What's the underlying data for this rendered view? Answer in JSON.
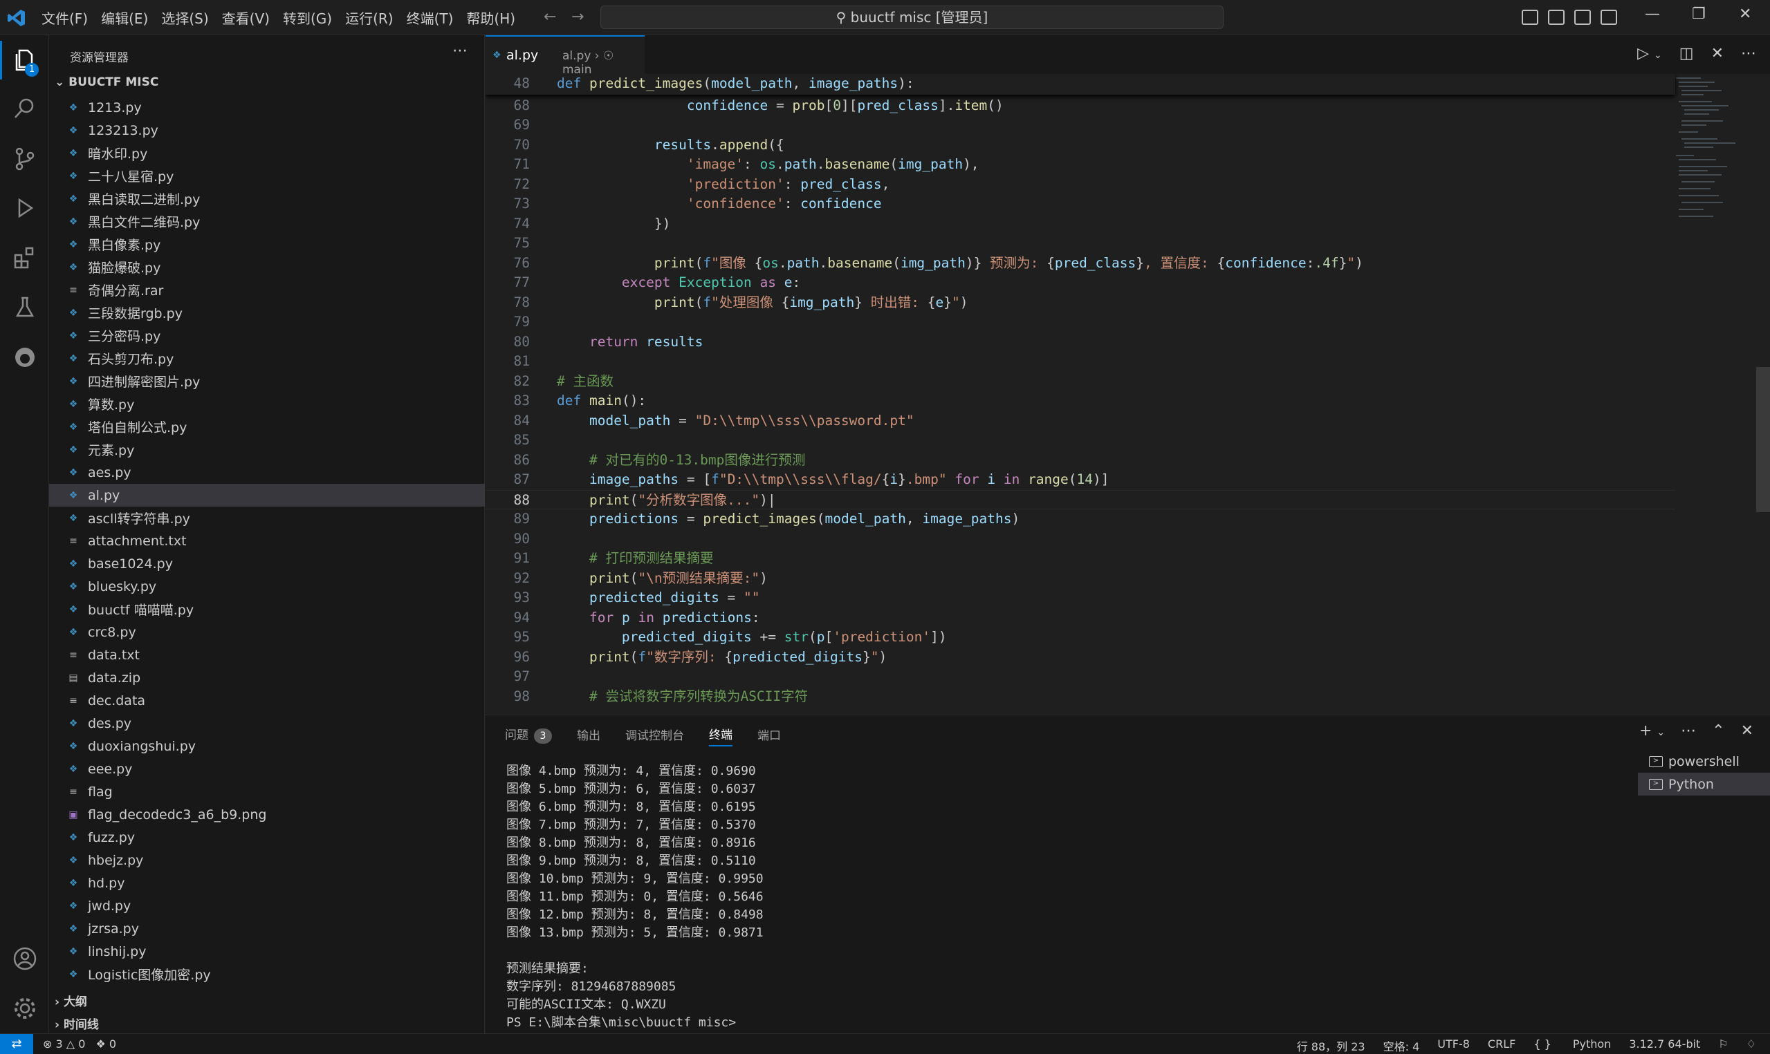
{
  "titlebar": {
    "menus": [
      "文件(F)",
      "编辑(E)",
      "选择(S)",
      "查看(V)",
      "转到(G)",
      "运行(R)",
      "终端(T)",
      "帮助(H)"
    ],
    "search": "buuctf misc [管理员]"
  },
  "activity": {
    "explorer_badge": "1"
  },
  "sidebar": {
    "title": "资源管理器",
    "section": "BUUCTF MISC",
    "files": [
      {
        "name": "1213.py",
        "type": "py"
      },
      {
        "name": "123213.py",
        "type": "py"
      },
      {
        "name": "暗水印.py",
        "type": "py"
      },
      {
        "name": "二十八星宿.py",
        "type": "py"
      },
      {
        "name": "黑白读取二进制.py",
        "type": "py"
      },
      {
        "name": "黑白文件二维码.py",
        "type": "py"
      },
      {
        "name": "黑白像素.py",
        "type": "py"
      },
      {
        "name": "猫脸爆破.py",
        "type": "py"
      },
      {
        "name": "奇偶分离.rar",
        "type": "txt"
      },
      {
        "name": "三段数据rgb.py",
        "type": "py"
      },
      {
        "name": "三分密码.py",
        "type": "py"
      },
      {
        "name": "石头剪刀布.py",
        "type": "py"
      },
      {
        "name": "四进制解密图片.py",
        "type": "py"
      },
      {
        "name": "算数.py",
        "type": "py"
      },
      {
        "name": "塔伯自制公式.py",
        "type": "py"
      },
      {
        "name": "元素.py",
        "type": "py"
      },
      {
        "name": "aes.py",
        "type": "py"
      },
      {
        "name": "al.py",
        "type": "py",
        "selected": true
      },
      {
        "name": "ascll转字符串.py",
        "type": "py"
      },
      {
        "name": "attachment.txt",
        "type": "txt"
      },
      {
        "name": "base1024.py",
        "type": "py"
      },
      {
        "name": "bluesky.py",
        "type": "py"
      },
      {
        "name": "buuctf 喵喵喵.py",
        "type": "py"
      },
      {
        "name": "crc8.py",
        "type": "py"
      },
      {
        "name": "data.txt",
        "type": "txt"
      },
      {
        "name": "data.zip",
        "type": "zip"
      },
      {
        "name": "dec.data",
        "type": "txt"
      },
      {
        "name": "des.py",
        "type": "py"
      },
      {
        "name": "duoxiangshui.py",
        "type": "py"
      },
      {
        "name": "eee.py",
        "type": "py"
      },
      {
        "name": "flag",
        "type": "txt"
      },
      {
        "name": "flag_decodedc3_a6_b9.png",
        "type": "png"
      },
      {
        "name": "fuzz.py",
        "type": "py"
      },
      {
        "name": "hbejz.py",
        "type": "py"
      },
      {
        "name": "hd.py",
        "type": "py"
      },
      {
        "name": "jwd.py",
        "type": "py"
      },
      {
        "name": "jzrsa.py",
        "type": "py"
      },
      {
        "name": "linshij.py",
        "type": "py"
      },
      {
        "name": "Logistic图像加密.py",
        "type": "py"
      }
    ],
    "outline": "大纲",
    "timeline": "时间线"
  },
  "editor": {
    "tab": "al.py",
    "breadcrumb": "al.py › ☉ main",
    "current_line": "88"
  },
  "panel": {
    "tabs": [
      "问题",
      "输出",
      "调试控制台",
      "终端",
      "端口"
    ],
    "problems_count": "3",
    "terminal_lines": [
      "图像 4.bmp 预测为: 4, 置信度: 0.9690",
      "图像 5.bmp 预测为: 6, 置信度: 0.6037",
      "图像 6.bmp 预测为: 8, 置信度: 0.6195",
      "图像 7.bmp 预测为: 7, 置信度: 0.5370",
      "图像 8.bmp 预测为: 8, 置信度: 0.8916",
      "图像 9.bmp 预测为: 8, 置信度: 0.5110",
      "图像 10.bmp 预测为: 9, 置信度: 0.9950",
      "图像 11.bmp 预测为: 0, 置信度: 0.5646",
      "图像 12.bmp 预测为: 8, 置信度: 0.8498",
      "图像 13.bmp 预测为: 5, 置信度: 0.9871",
      "",
      "预测结果摘要:",
      "数字序列: 81294687889085",
      "可能的ASCII文本: Q.WXZU",
      "PS E:\\脚本合集\\misc\\buuctf misc> "
    ],
    "terminals": [
      "powershell",
      "Python"
    ]
  },
  "statusbar": {
    "errors": "3",
    "warnings": "0",
    "ports": "0",
    "position": "行 88，列 23",
    "spaces": "空格: 4",
    "encoding": "UTF-8",
    "eol": "CRLF",
    "language": "Python",
    "interpreter": "3.12.7 64-bit"
  }
}
